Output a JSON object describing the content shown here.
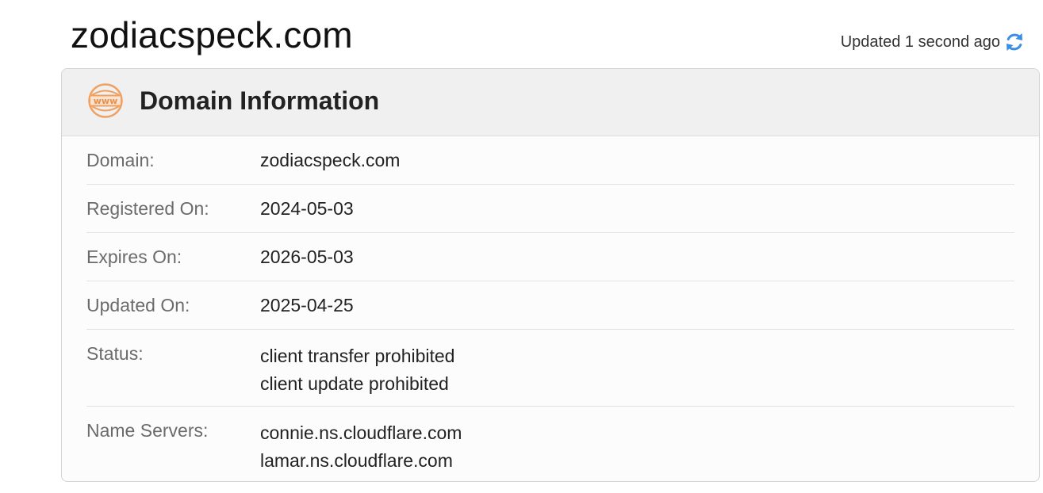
{
  "page": {
    "title": "zodiacspeck.com",
    "updated_text": "Updated 1 second ago",
    "refresh_icon": "refresh-icon"
  },
  "card": {
    "icon": "www-icon",
    "icon_text": "www",
    "title": "Domain Information",
    "accent_color": "#f0a060",
    "refresh_color": "#3a8ee6"
  },
  "rows": [
    {
      "label": "Domain:",
      "values": [
        "zodiacspeck.com"
      ]
    },
    {
      "label": "Registered On:",
      "values": [
        "2024-05-03"
      ]
    },
    {
      "label": "Expires On:",
      "values": [
        "2026-05-03"
      ]
    },
    {
      "label": "Updated On:",
      "values": [
        "2025-04-25"
      ]
    },
    {
      "label": "Status:",
      "values": [
        "client transfer prohibited",
        "client update prohibited"
      ]
    },
    {
      "label": "Name Servers:",
      "values": [
        "connie.ns.cloudflare.com",
        "lamar.ns.cloudflare.com"
      ]
    }
  ]
}
